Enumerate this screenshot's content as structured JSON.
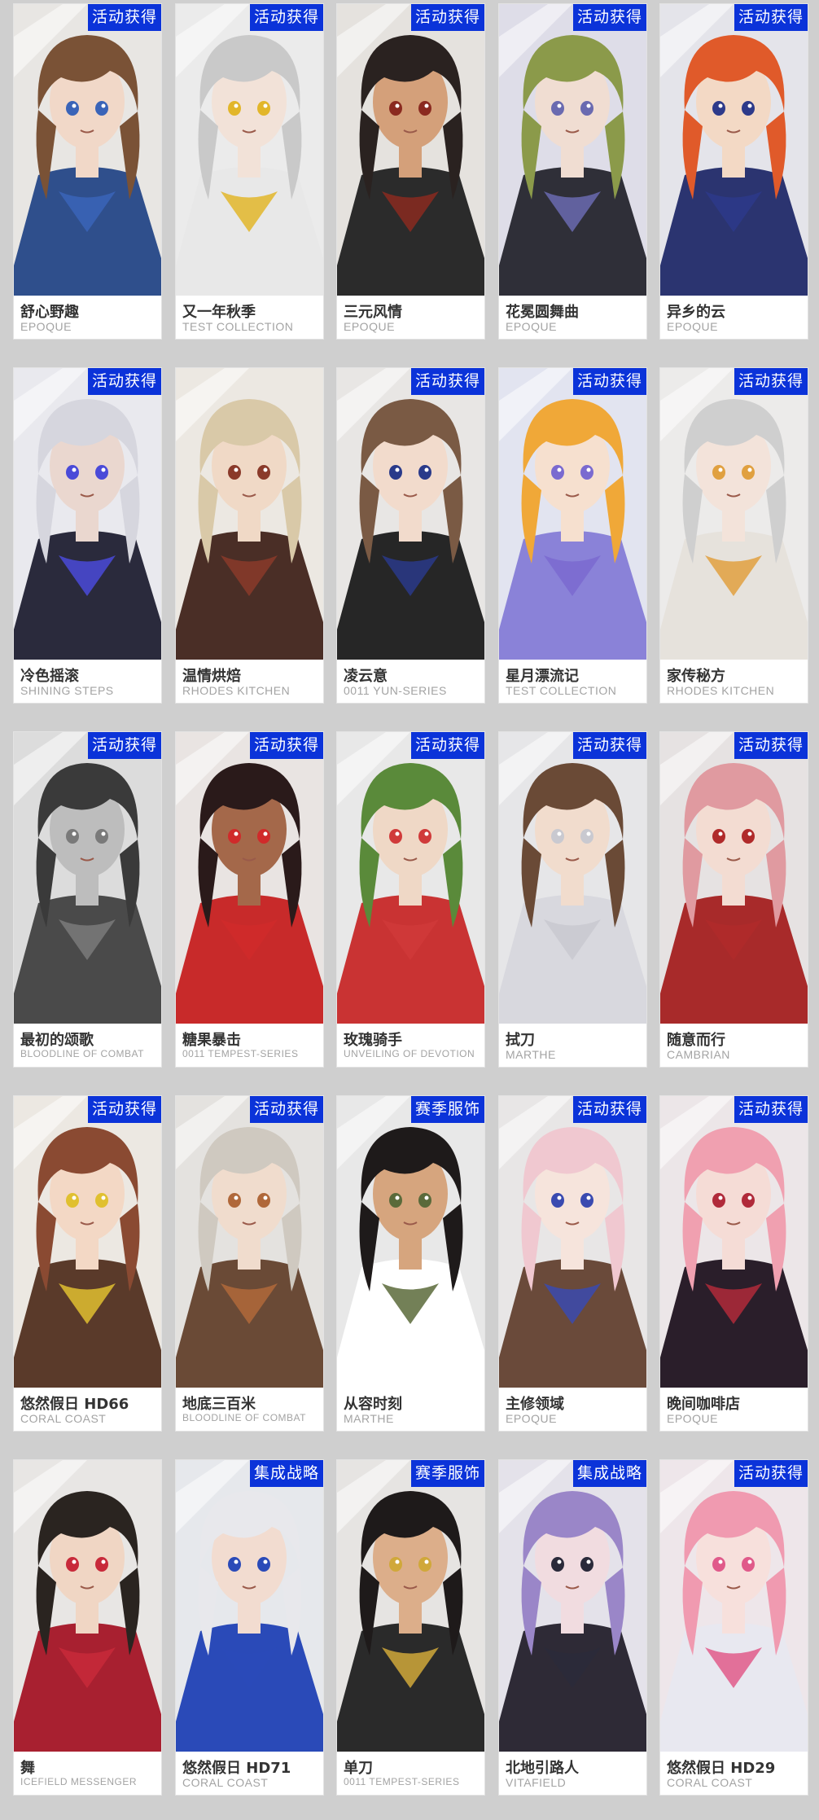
{
  "cards": [
    {
      "name": "舒心野趣",
      "series": "EPOQUE",
      "badge": "活动获得",
      "colors": {
        "bg": "#e8e6e3",
        "hair": "#7a5236",
        "accent": "#3a64b8",
        "skin": "#f1d8c8",
        "outfit": "#2f4f8c"
      }
    },
    {
      "name": "又一年秋季",
      "series": "TEST COLLECTION",
      "badge": "活动获得",
      "colors": {
        "bg": "#ebebeb",
        "hair": "#c9c9c9",
        "accent": "#e2b62a",
        "skin": "#f2e2d8",
        "outfit": "#e8e8e8"
      }
    },
    {
      "name": "三元风情",
      "series": "EPOQUE",
      "badge": "活动获得",
      "colors": {
        "bg": "#e5e2de",
        "hair": "#2a2220",
        "accent": "#8a2a20",
        "skin": "#d4a07a",
        "outfit": "#2b2b2b"
      }
    },
    {
      "name": "花冕圆舞曲",
      "series": "EPOQUE",
      "badge": "活动获得",
      "colors": {
        "bg": "#dedde8",
        "hair": "#8b9a4a",
        "accent": "#6a6ab0",
        "skin": "#f0ddd2",
        "outfit": "#2f2f38"
      }
    },
    {
      "name": "异乡的云",
      "series": "EPOQUE",
      "badge": "活动获得",
      "colors": {
        "bg": "#e4e4ea",
        "hair": "#e05a2a",
        "accent": "#2d3a8a",
        "skin": "#f3d9c5",
        "outfit": "#2b3470"
      }
    },
    {
      "name": "冷色摇滚",
      "series": "SHINING STEPS",
      "badge": "活动获得",
      "colors": {
        "bg": "#e9e9ee",
        "hair": "#d6d6de",
        "accent": "#4a4ad8",
        "skin": "#ead7cf",
        "outfit": "#2a2a3c"
      }
    },
    {
      "name": "温情烘焙",
      "series": "RHODES KITCHEN",
      "badge": "",
      "colors": {
        "bg": "#ece8e2",
        "hair": "#d9c9a8",
        "accent": "#8a3a2a",
        "skin": "#f0d9c6",
        "outfit": "#4a2e26"
      }
    },
    {
      "name": "凌云意",
      "series": "0011 YUN-SERIES",
      "badge": "活动获得",
      "colors": {
        "bg": "#e8e6e4",
        "hair": "#7a5a44",
        "accent": "#2a3a8a",
        "skin": "#f2dbcc",
        "outfit": "#262626"
      }
    },
    {
      "name": "星月漂流记",
      "series": "TEST COLLECTION",
      "badge": "活动获得",
      "colors": {
        "bg": "#e2e4f0",
        "hair": "#f0a838",
        "accent": "#7a6ad0",
        "skin": "#f6e0cf",
        "outfit": "#8a82d8"
      }
    },
    {
      "name": "家传秘方",
      "series": "RHODES KITCHEN",
      "badge": "活动获得",
      "colors": {
        "bg": "#ecebea",
        "hair": "#cfcfcf",
        "accent": "#e0a040",
        "skin": "#f3e3da",
        "outfit": "#e6e2dc"
      }
    },
    {
      "name": "最初的颂歌",
      "series": "BLOODLINE OF COMBAT",
      "badge": "活动获得",
      "colors": {
        "bg": "#dcdcdc",
        "hair": "#3a3a3a",
        "accent": "#7a7a7a",
        "skin": "#bdbdbd",
        "outfit": "#4a4a4a"
      }
    },
    {
      "name": "糖果暴击",
      "series": "0011 TEMPEST-SERIES",
      "badge": "活动获得",
      "colors": {
        "bg": "#e9e4e2",
        "hair": "#2a1a1a",
        "accent": "#d02a2a",
        "skin": "#a4684a",
        "outfit": "#c82a2a"
      }
    },
    {
      "name": "玫瑰骑手",
      "series": "UNVEILING OF DEVOTION",
      "badge": "活动获得",
      "colors": {
        "bg": "#e8e8e8",
        "hair": "#5a8a3a",
        "accent": "#d03a3a",
        "skin": "#efd8c6",
        "outfit": "#c93333"
      }
    },
    {
      "name": "拭刀",
      "series": "MARTHE",
      "badge": "活动获得",
      "colors": {
        "bg": "#e6e6e8",
        "hair": "#6a4a36",
        "accent": "#c9c9d0",
        "skin": "#f1dccd",
        "outfit": "#d8d8de"
      }
    },
    {
      "name": "随意而行",
      "series": "CAMBRIAN",
      "badge": "活动获得",
      "colors": {
        "bg": "#e6e2e2",
        "hair": "#e09aa0",
        "accent": "#b02a2a",
        "skin": "#f3dcd2",
        "outfit": "#a82a2a"
      }
    },
    {
      "name": "悠然假日 HD66",
      "series": "CORAL COAST",
      "badge": "活动获得",
      "colors": {
        "bg": "#ece8e2",
        "hair": "#8a4a32",
        "accent": "#e0c030",
        "skin": "#f3d8c5",
        "outfit": "#5a3a2a"
      }
    },
    {
      "name": "地底三百米",
      "series": "BLOODLINE OF COMBAT",
      "badge": "活动获得",
      "colors": {
        "bg": "#e4e2df",
        "hair": "#cfc9c0",
        "accent": "#b0683a",
        "skin": "#f0dccd",
        "outfit": "#6a4a36"
      }
    },
    {
      "name": "从容时刻",
      "series": "MARTHE",
      "badge": "赛季服饰",
      "colors": {
        "bg": "#e8e8e8",
        "hair": "#1e1a1a",
        "accent": "#5a6a3a",
        "skin": "#d6a57e",
        "outfit": "#ffffff"
      }
    },
    {
      "name": "主修领域",
      "series": "EPOQUE",
      "badge": "活动获得",
      "colors": {
        "bg": "#e8e6e6",
        "hair": "#f0c8d0",
        "accent": "#3a4ab0",
        "skin": "#f6e4dc",
        "outfit": "#6a4a3a"
      }
    },
    {
      "name": "晚间咖啡店",
      "series": "EPOQUE",
      "badge": "活动获得",
      "colors": {
        "bg": "#ece6e8",
        "hair": "#f0a0b0",
        "accent": "#b02a3a",
        "skin": "#f5dcd6",
        "outfit": "#2a1e2a"
      }
    },
    {
      "name": "舞",
      "series": "ICEFIELD MESSENGER",
      "badge": "",
      "colors": {
        "bg": "#e8e6e4",
        "hair": "#2a2420",
        "accent": "#c82a3a",
        "skin": "#f0d6c4",
        "outfit": "#a82030"
      }
    },
    {
      "name": "悠然假日 HD71",
      "series": "CORAL COAST",
      "badge": "集成战略",
      "colors": {
        "bg": "#e6e8ec",
        "hair": "#e8e8ec",
        "accent": "#2a4ab8",
        "skin": "#f2dcd0",
        "outfit": "#2a4ab8"
      }
    },
    {
      "name": "单刀",
      "series": "0011 TEMPEST-SERIES",
      "badge": "赛季服饰",
      "colors": {
        "bg": "#e6e4e2",
        "hair": "#1e1a1a",
        "accent": "#d0a83a",
        "skin": "#dcae8a",
        "outfit": "#2a2a2a"
      }
    },
    {
      "name": "北地引路人",
      "series": "VITAFIELD",
      "badge": "集成战略",
      "colors": {
        "bg": "#e4e2ea",
        "hair": "#9a86c8",
        "accent": "#2a2a3a",
        "skin": "#f1dce0",
        "outfit": "#2e2a36"
      }
    },
    {
      "name": "悠然假日 HD29",
      "series": "CORAL COAST",
      "badge": "活动获得",
      "colors": {
        "bg": "#eee6ea",
        "hair": "#f09ab0",
        "accent": "#e05a8a",
        "skin": "#f7e0dc",
        "outfit": "#e8e8f0"
      }
    }
  ]
}
